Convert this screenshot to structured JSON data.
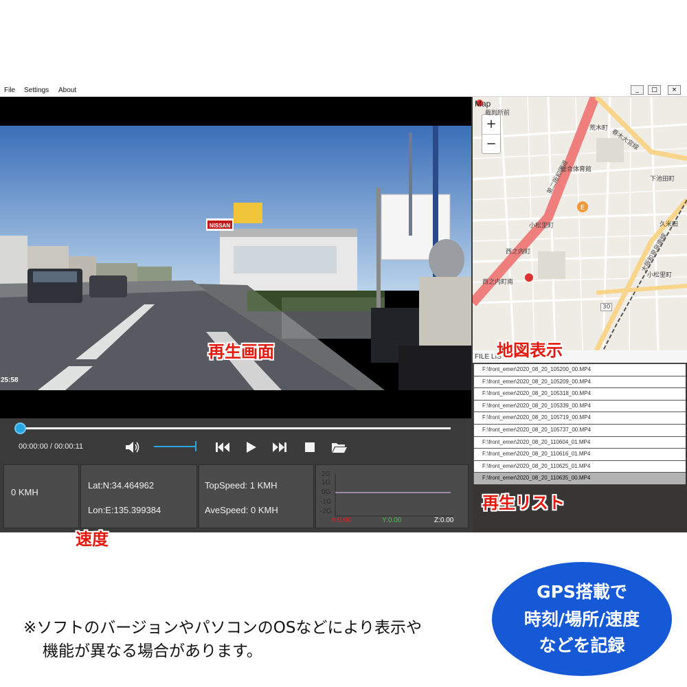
{
  "menu": {
    "file": "File",
    "settings": "Settings",
    "about": "About"
  },
  "window_controls": {
    "minimize": "_",
    "maximize": "□",
    "close": "×"
  },
  "video": {
    "timestamp": "25:58",
    "signs": {
      "nissan": "NISSAN"
    }
  },
  "player": {
    "time": "00:00:00 / 00:00:11",
    "progress": 0.0,
    "volume": 1.0
  },
  "info": {
    "speed": "0 KMH",
    "lat": "Lat:N:34.464962",
    "lon": "Lon:E:135.399384",
    "top_speed": "TopSpeed: 1 KMH",
    "ave_speed": "AveSpeed: 0 KMH",
    "gsensor": {
      "ticks": [
        "2G",
        "1G",
        "0G",
        "-1G",
        "-2G"
      ],
      "x": "X:0.00",
      "y": "Y:0.00",
      "z": "Z:0.00"
    }
  },
  "map": {
    "title": "Map",
    "zoom_in": "+",
    "zoom_out": "−",
    "labels": {
      "l1": "裁判所前",
      "l2": "荒木町",
      "l3": "総合体育館",
      "l4": "下池田町",
      "l5": "小松里町",
      "l6": "西之内町",
      "l7": "久米田",
      "l8": "西之内町南",
      "l9": "小松里町",
      "l10": "30"
    },
    "roads": {
      "r1": "第二阪和国道",
      "r2": "春木大宮線",
      "r3": "大阪和泉泉南線"
    }
  },
  "file_list": {
    "header": "FILE LIST",
    "files": [
      "F:\\front_emer\\2020_08_20_105200_00.MP4",
      "F:\\front_emer\\2020_08_20_105209_00.MP4",
      "F:\\front_emer\\2020_08_20_105318_00.MP4",
      "F:\\front_emer\\2020_08_20_105339_00.MP4",
      "F:\\front_emer\\2020_08_20_105719_00.MP4",
      "F:\\front_emer\\2020_08_20_105737_00.MP4",
      "F:\\front_emer\\2020_08_20_110604_01.MP4",
      "F:\\front_emer\\2020_08_20_110616_01.MP4",
      "F:\\front_emer\\2020_08_20_110625_01.MP4",
      "F:\\front_emer\\2020_08_20_110635_00.MP4"
    ],
    "selected_index": 9
  },
  "annotations": {
    "playback_screen": "再生画面",
    "map_display": "地図表示",
    "playlist": "再生リスト",
    "speed": "速度"
  },
  "note": {
    "line1": "※ソフトのバージョンやパソコンのOSなどにより表示や",
    "line2": "機能が異なる場合があります。"
  },
  "badge": {
    "line1": "GPS搭載で",
    "line2": "時刻/場所/速度",
    "line3": "などを記録"
  },
  "colors": {
    "accent": "#29a7e1",
    "callout": "#e4190e",
    "badge": "#1659d6",
    "x_axis": "#e02020",
    "y_axis": "#3ec84a",
    "z_axis": "#ffffff"
  }
}
